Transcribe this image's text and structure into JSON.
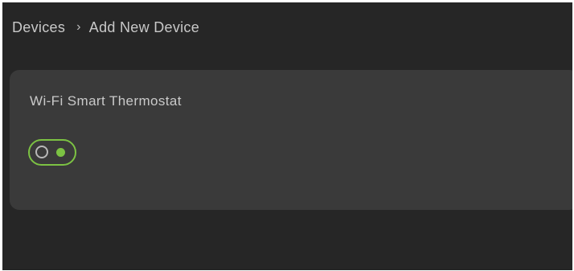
{
  "breadcrumb": {
    "parent": "Devices",
    "separator": "›",
    "current": "Add New Device"
  },
  "device": {
    "name": "Wi-Fi Smart Thermostat",
    "enabled": true
  },
  "colors": {
    "background": "#262626",
    "card": "#3a3a3a",
    "accent": "#7cc243",
    "text": "#c8c8c8"
  },
  "icons": {
    "toggle_off_marker": "ring-icon",
    "toggle_on_marker": "knob-icon"
  }
}
